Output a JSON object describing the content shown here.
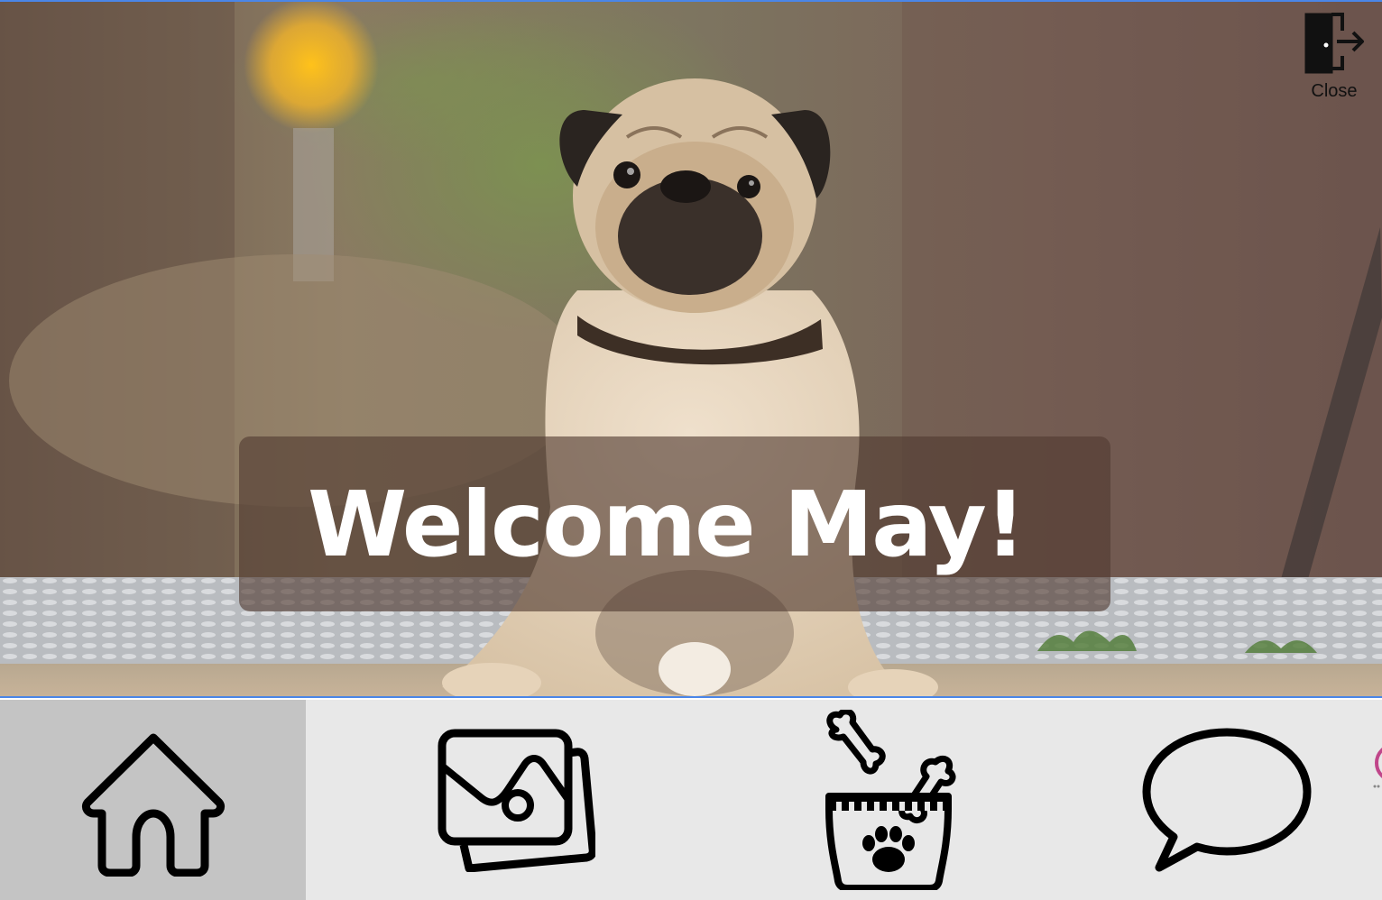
{
  "header": {
    "close_label": "Close"
  },
  "hero": {
    "welcome_text": "Welcome May!"
  },
  "nav": {
    "active": "home",
    "items": [
      {
        "id": "home",
        "icon": "home-icon"
      },
      {
        "id": "gallery",
        "icon": "gallery-icon"
      },
      {
        "id": "food",
        "icon": "dog-food-icon"
      },
      {
        "id": "chat",
        "icon": "chat-bubble-icon"
      }
    ]
  },
  "colors": {
    "accent_border": "#4a86e8",
    "nav_background": "#e8e8e8",
    "nav_active": "#c4c4c4",
    "banner_overlay": "rgba(80,58,48,0.62)",
    "text_light": "#ffffff"
  }
}
